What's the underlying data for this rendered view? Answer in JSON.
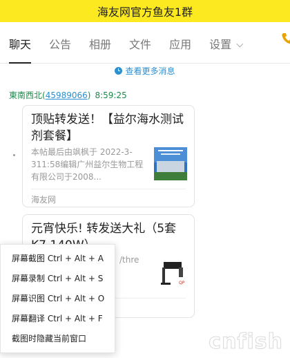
{
  "window": {
    "title": "海友网官方鱼友1群"
  },
  "tabs": [
    {
      "label": "聊天",
      "active": true
    },
    {
      "label": "公告"
    },
    {
      "label": "相册"
    },
    {
      "label": "文件"
    },
    {
      "label": "应用"
    },
    {
      "label": "设置"
    }
  ],
  "more_messages": "查看更多消息",
  "message": {
    "sender_name": "東南西北",
    "sender_id_open": "(",
    "sender_id": "45989066",
    "sender_id_close": ")",
    "time": "8:59:25"
  },
  "cards": [
    {
      "title": "顶贴转发送！【益尔海水测试剂套餐】",
      "desc": "本帖最后由飒枫于 2022-3-311:58编辑广州益尔生物工程有限公司于2008...",
      "source": "海友网"
    },
    {
      "title": "元宵快乐! 转发送大礼（5套K7 140W）",
      "desc_partial": "/thre"
    }
  ],
  "context_menu": [
    "屏幕截图 Ctrl + Alt + A",
    "屏幕录制 Ctrl + Alt + S",
    "屏幕识图 Ctrl + Alt + O",
    "屏幕翻译 Ctrl + Alt + F",
    "截图时隐藏当前窗口"
  ],
  "watermark": "cnfish",
  "colors": {
    "titlebar_bg": "#fde920",
    "link": "#2b8fd0",
    "sender": "#1b8a4a"
  },
  "icons": [
    "clock-icon",
    "chevron-down-icon",
    "phone-icon",
    "card-thumbnail"
  ]
}
